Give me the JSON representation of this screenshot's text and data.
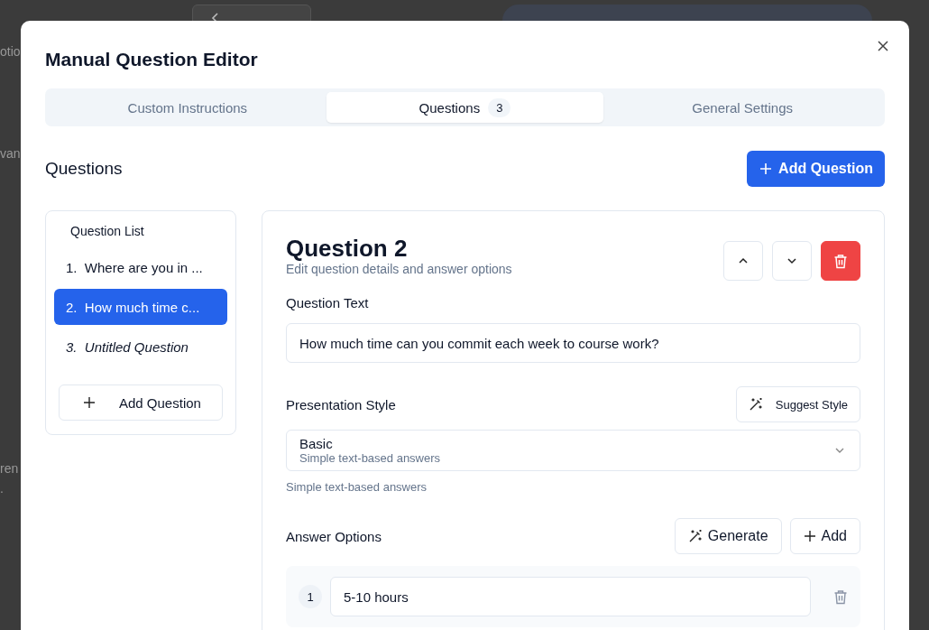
{
  "background": {
    "fragments": [
      "otio",
      "van",
      "ren",
      "."
    ]
  },
  "dialog": {
    "title": "Manual Question Editor"
  },
  "tabs": [
    {
      "label": "Custom Instructions",
      "selected": false
    },
    {
      "label": "Questions",
      "badge": "3",
      "selected": true
    },
    {
      "label": "General Settings",
      "selected": false
    }
  ],
  "section_title": "Questions",
  "add_question_button": "Add Question",
  "question_list": {
    "title": "Question List",
    "items": [
      {
        "number": "1.",
        "label": "Where are you in ...",
        "selected": false,
        "untitled": false
      },
      {
        "number": "2.",
        "label": "How much time c...",
        "selected": true,
        "untitled": false
      },
      {
        "number": "3.",
        "label": "Untitled Question",
        "selected": false,
        "untitled": true
      }
    ],
    "add_button": "Add Question"
  },
  "editor": {
    "title": "Question 2",
    "subtitle": "Edit question details and answer options",
    "question_text_label": "Question Text",
    "question_text": "How much time can you commit each week to course work?",
    "presentation_label": "Presentation Style",
    "suggest_button": "Suggest Style",
    "style_value": "Basic",
    "style_description": "Simple text-based answers",
    "style_help": "Simple text-based answers",
    "answers_label": "Answer Options",
    "generate_button": "Generate",
    "add_button": "Add",
    "answers": [
      {
        "number": "1",
        "value": "5-10 hours"
      }
    ]
  }
}
